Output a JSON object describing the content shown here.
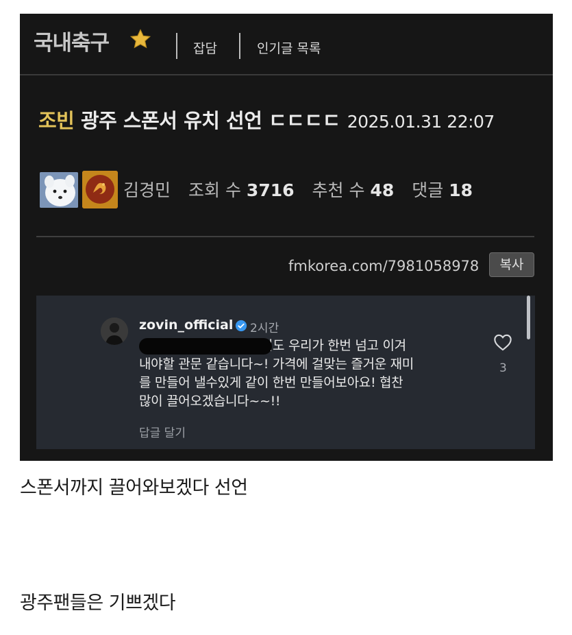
{
  "board": {
    "title": "국내축구",
    "nav": [
      "잡담",
      "인기글 목록"
    ]
  },
  "post": {
    "tag": "조빈",
    "title": " 광주 스폰서 유치 선언 ㄷㄷㄷㄷ",
    "date": "2025.01.31 22:07",
    "author": "김경민",
    "views_label": "조회 수",
    "views": "3716",
    "likes_label": "추천 수",
    "likes": "48",
    "comments_label": "댓글",
    "comments": "18",
    "url": "fmkorea.com/7981058978",
    "copy_label": "복사"
  },
  "comment": {
    "username": "zovin_official",
    "time": "2시간",
    "text": "                         이마저도 우리가 한번 넘고 이겨\n내야할 관문 같습니다~! 가격에 걸맞는 즐거운 재미\n를 만들어 낼수있게 같이 한번 만들어보아요! 협찬\n많이 끌어오겠습니다~~!!",
    "reply_label": "답글 달기",
    "like_count": "3"
  },
  "body": {
    "line1": "스폰서까지 끌어와보겠다 선언",
    "line2": "광주팬들은 기쁘겠다"
  },
  "colors": {
    "background_dark": "#161616",
    "tag_gold": "#e3c35a",
    "comment_bg": "#262a31",
    "verified_blue": "#3897f0"
  }
}
